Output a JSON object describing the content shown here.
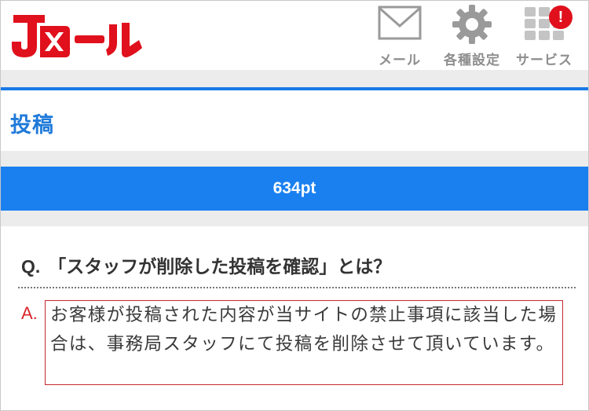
{
  "header": {
    "logo_text": "Jメール",
    "nav": [
      {
        "label": "メール",
        "icon": "mail-icon"
      },
      {
        "label": "各種設定",
        "icon": "gear-icon"
      },
      {
        "label": "サービス",
        "icon": "grid-icon",
        "badge": "!"
      }
    ]
  },
  "page": {
    "title": "投稿",
    "points": "634pt"
  },
  "faq": {
    "q_prefix": "Q.",
    "question": "「スタッフが削除した投稿を確認」とは？",
    "a_prefix": "A.",
    "answer": "お客様が投稿された内容が当サイトの禁止事項に該当した場合は、事務局スタッフにて投稿を削除させて頂いています。"
  },
  "colors": {
    "brand_red": "#e0101c",
    "accent_blue": "#1a80f0",
    "title_blue": "#1f7ad9",
    "answer_border": "#c5282e"
  }
}
